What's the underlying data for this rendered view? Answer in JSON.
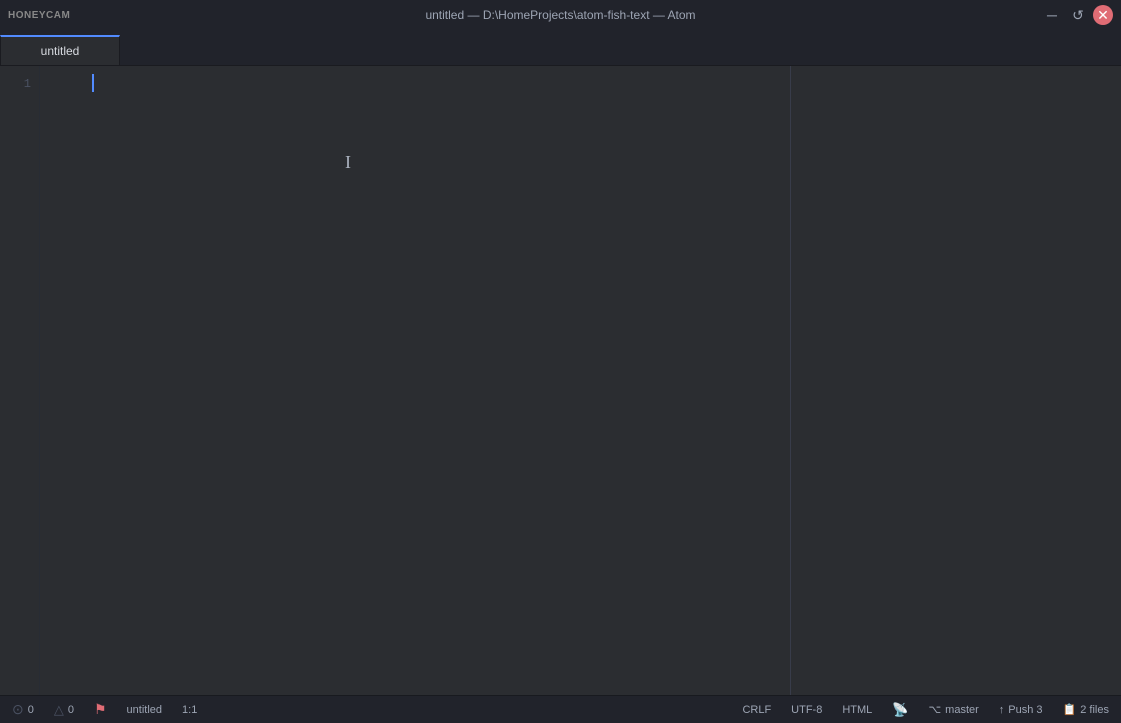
{
  "titlebar": {
    "logo": "HONEYCAM",
    "title": "untitled — D:\\HomeProjects\\atom-fish-text — Atom",
    "minimize_label": "─",
    "refresh_label": "↺",
    "close_label": "✕"
  },
  "tabs": [
    {
      "label": "untitled",
      "active": true
    }
  ],
  "editor": {
    "line_numbers": [
      "1"
    ],
    "content": ""
  },
  "statusbar": {
    "errors": "0",
    "warnings": "0",
    "filename": "untitled",
    "cursor_position": "1:1",
    "line_ending": "CRLF",
    "encoding": "UTF-8",
    "language": "HTML",
    "broadcast_label": "",
    "branch": "master",
    "push": "Push 3",
    "files": "2 files"
  }
}
